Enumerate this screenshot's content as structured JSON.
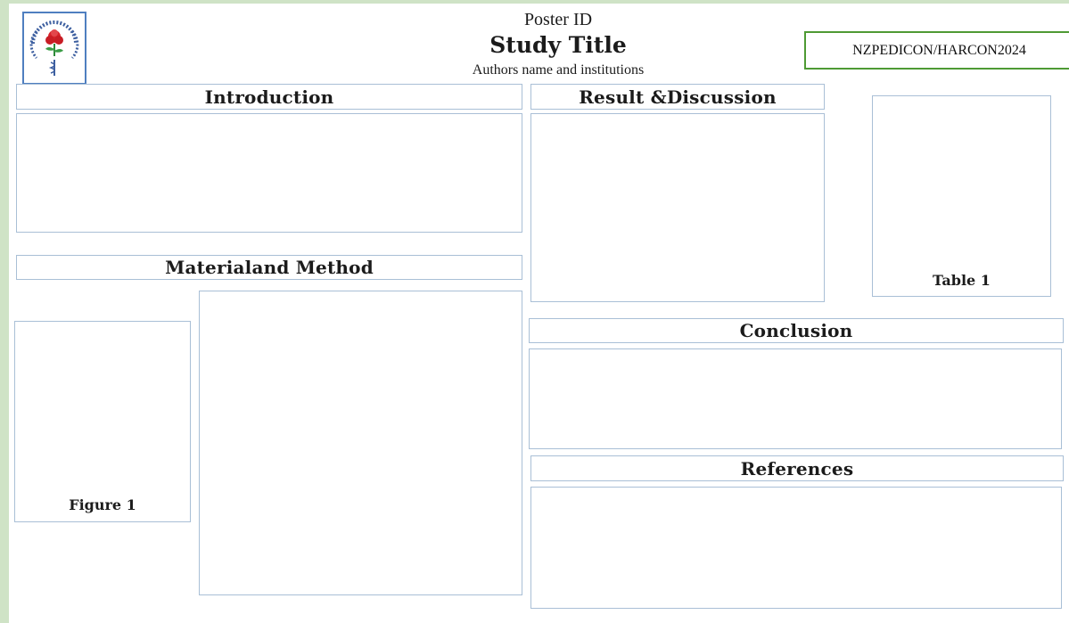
{
  "header": {
    "poster_id": "Poster ID",
    "study_title": "Study Title",
    "authors": "Authors name and institutions",
    "conference": "NZPEDICON/HARCON2024",
    "logo_icon": "indian-academy-of-pediatrics-logo"
  },
  "sections": {
    "introduction": "Introduction",
    "material_method": "Materialand Method",
    "result_discussion": "Result &Discussion",
    "conclusion": "Conclusion",
    "references": "References"
  },
  "captions": {
    "figure": "Figure 1",
    "table": "Table 1"
  },
  "colors": {
    "background": "#cfe3c6",
    "box_border": "#a9bfd6",
    "conference_border": "#4e9a34",
    "logo_border": "#4f7fc0"
  }
}
